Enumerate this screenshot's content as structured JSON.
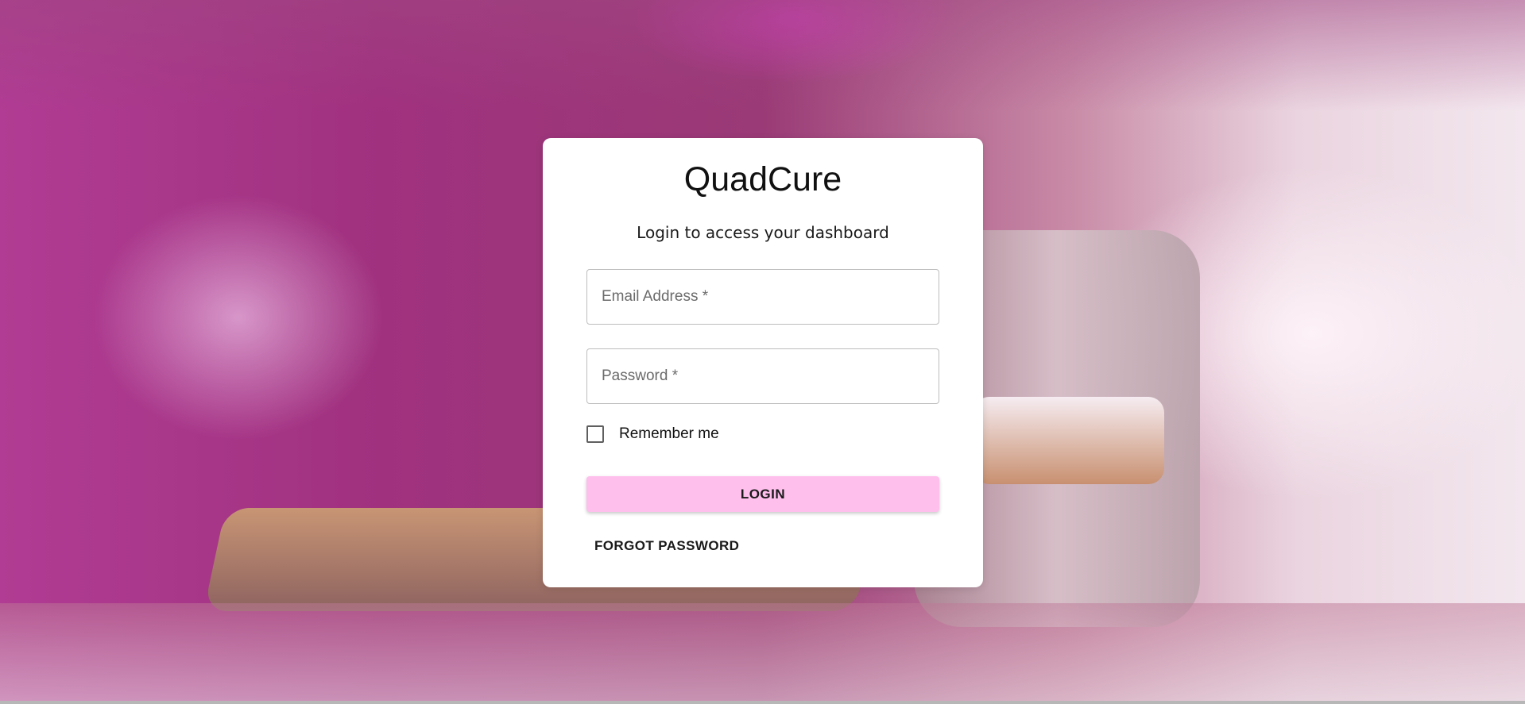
{
  "app": {
    "title": "QuadCure",
    "subtitle": "Login to access your dashboard"
  },
  "form": {
    "email": {
      "placeholder": "Email Address *",
      "value": ""
    },
    "password": {
      "placeholder": "Password *",
      "value": ""
    },
    "remember": {
      "label": "Remember me",
      "checked": false
    },
    "login_label": "LOGIN",
    "forgot_label": "FORGOT PASSWORD"
  },
  "colors": {
    "login_button": "#ffbfec",
    "card_background": "#ffffff"
  }
}
